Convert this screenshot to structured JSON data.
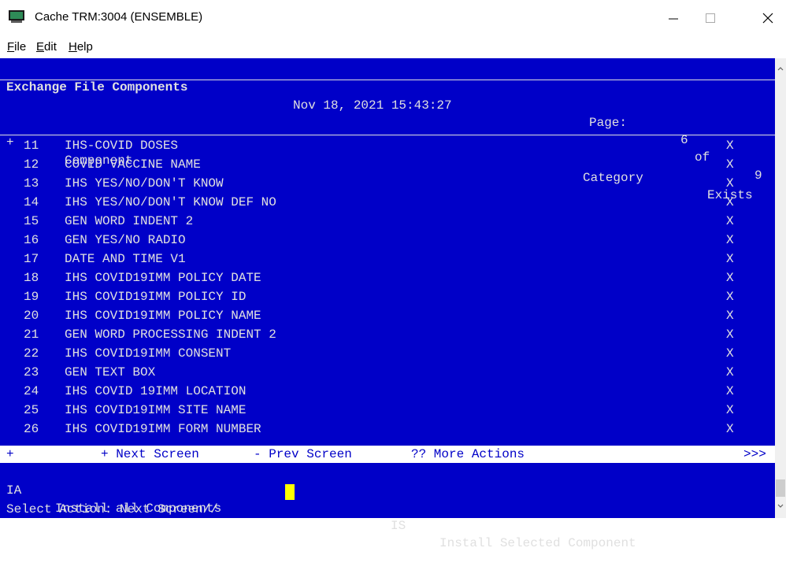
{
  "window": {
    "title": "Cache TRM:3004 (ENSEMBLE)",
    "minimize_icon": "minimize-icon",
    "maximize_icon": "maximize-icon",
    "close_icon": "close-icon"
  },
  "menu": {
    "file": "File",
    "edit": "Edit",
    "help": "Help"
  },
  "header": {
    "screen_title": "Exchange File Components",
    "datetime": "Nov 18, 2021 15:43:27",
    "page_label": "Page:",
    "page_current": "6",
    "page_of": "of",
    "page_total": "9"
  },
  "columns": {
    "marker": "+",
    "component": "Component",
    "category": "Category",
    "exists": "Exists"
  },
  "rows": [
    {
      "num": "11",
      "name": "IHS-COVID DOSES",
      "category": "",
      "exists": "X"
    },
    {
      "num": "12",
      "name": "COVID VACCINE NAME",
      "category": "",
      "exists": "X"
    },
    {
      "num": "13",
      "name": "IHS YES/NO/DON'T KNOW",
      "category": "",
      "exists": "X"
    },
    {
      "num": "14",
      "name": "IHS YES/NO/DON'T KNOW DEF NO",
      "category": "",
      "exists": "X"
    },
    {
      "num": "15",
      "name": "GEN WORD INDENT 2",
      "category": "",
      "exists": "X"
    },
    {
      "num": "16",
      "name": "GEN YES/NO RADIO",
      "category": "",
      "exists": "X"
    },
    {
      "num": "17",
      "name": "DATE AND TIME V1",
      "category": "",
      "exists": "X"
    },
    {
      "num": "18",
      "name": "IHS COVID19IMM POLICY DATE",
      "category": "",
      "exists": "X"
    },
    {
      "num": "19",
      "name": "IHS COVID19IMM POLICY ID",
      "category": "",
      "exists": "X"
    },
    {
      "num": "20",
      "name": "IHS COVID19IMM POLICY NAME",
      "category": "",
      "exists": "X"
    },
    {
      "num": "21",
      "name": "GEN WORD PROCESSING INDENT 2",
      "category": "",
      "exists": "X"
    },
    {
      "num": "22",
      "name": "IHS COVID19IMM CONSENT",
      "category": "",
      "exists": "X"
    },
    {
      "num": "23",
      "name": "GEN TEXT BOX",
      "category": "",
      "exists": "X"
    },
    {
      "num": "24",
      "name": "IHS COVID 19IMM LOCATION",
      "category": "",
      "exists": "X"
    },
    {
      "num": "25",
      "name": "IHS COVID19IMM SITE NAME",
      "category": "",
      "exists": "X"
    },
    {
      "num": "26",
      "name": "IHS COVID19IMM FORM NUMBER",
      "category": "",
      "exists": "X"
    }
  ],
  "footer": {
    "marker": "+",
    "next": "+ Next Screen",
    "prev": "- Prev Screen",
    "more": "?? More Actions",
    "arrows": ">>>"
  },
  "actions": [
    {
      "code": "IA",
      "label": "Install all Components"
    },
    {
      "code": "IS",
      "label": "Install Selected Component"
    }
  ],
  "prompt": "Select Action: Next Screen//",
  "colors": {
    "terminal_bg": "#0000c8",
    "terminal_fg": "#e0e0e0",
    "cursor": "#ffff00"
  }
}
